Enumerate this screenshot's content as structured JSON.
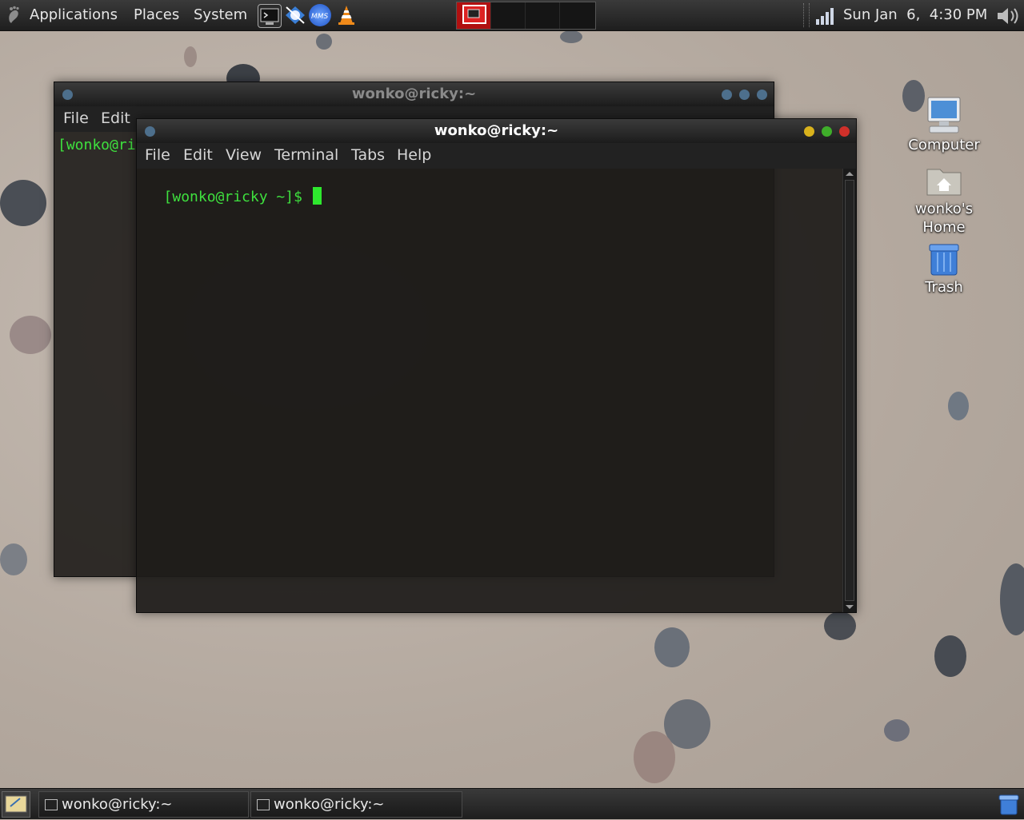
{
  "top_panel": {
    "menus": [
      "Applications",
      "Places",
      "System"
    ],
    "launchers": [
      "terminal-launcher-icon",
      "network-app-icon",
      "mms-app-icon",
      "vlc-cone-icon"
    ],
    "clock": "Sun Jan  6,  4:30 PM"
  },
  "desktop_icons": [
    {
      "name": "Computer",
      "icon": "computer-icon"
    },
    {
      "name": "wonko's Home",
      "line1": "wonko's",
      "line2": "Home",
      "icon": "home-folder-icon"
    },
    {
      "name": "Trash",
      "icon": "trash-icon"
    }
  ],
  "back_window": {
    "title": "wonko@ricky:~",
    "menus": [
      "File",
      "Edit"
    ],
    "prompt": "[wonko@ri"
  },
  "front_window": {
    "title": "wonko@ricky:~",
    "menus": [
      "File",
      "Edit",
      "View",
      "Terminal",
      "Tabs",
      "Help"
    ],
    "prompt": "[wonko@ricky ~]$ "
  },
  "taskbar": {
    "tasks": [
      {
        "label": "wonko@ricky:~"
      },
      {
        "label": "wonko@ricky:~"
      }
    ]
  },
  "colors": {
    "prompt_green": "#3ee03e",
    "panel_bg": "#2a2a2a",
    "sand": "#b8ada4"
  }
}
